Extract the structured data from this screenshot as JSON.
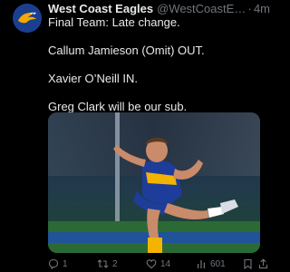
{
  "account": {
    "name": "West Coast Eagles",
    "handle": "@WestCoastEag...",
    "separator": "·",
    "time": "4m",
    "avatar_icon": "eagle-logo-icon",
    "brand_color": "#1a3f8f",
    "accent_color": "#f2a900"
  },
  "tweet": {
    "line1": "Final Team: Late change.",
    "line2": "Callum Jamieson (Omit) OUT.",
    "line3": "Xavier O’Neill IN.",
    "line4": "Greg Clark will be our sub."
  },
  "media": {
    "description_icon": "football-player-photo"
  },
  "actions": {
    "reply": {
      "icon": "reply-icon",
      "count": "1"
    },
    "retweet": {
      "icon": "retweet-icon",
      "count": "2"
    },
    "like": {
      "icon": "heart-icon",
      "count": "14"
    },
    "views": {
      "icon": "views-icon",
      "count": "601"
    },
    "bookmark": {
      "icon": "bookmark-icon"
    },
    "share": {
      "icon": "share-icon"
    }
  }
}
